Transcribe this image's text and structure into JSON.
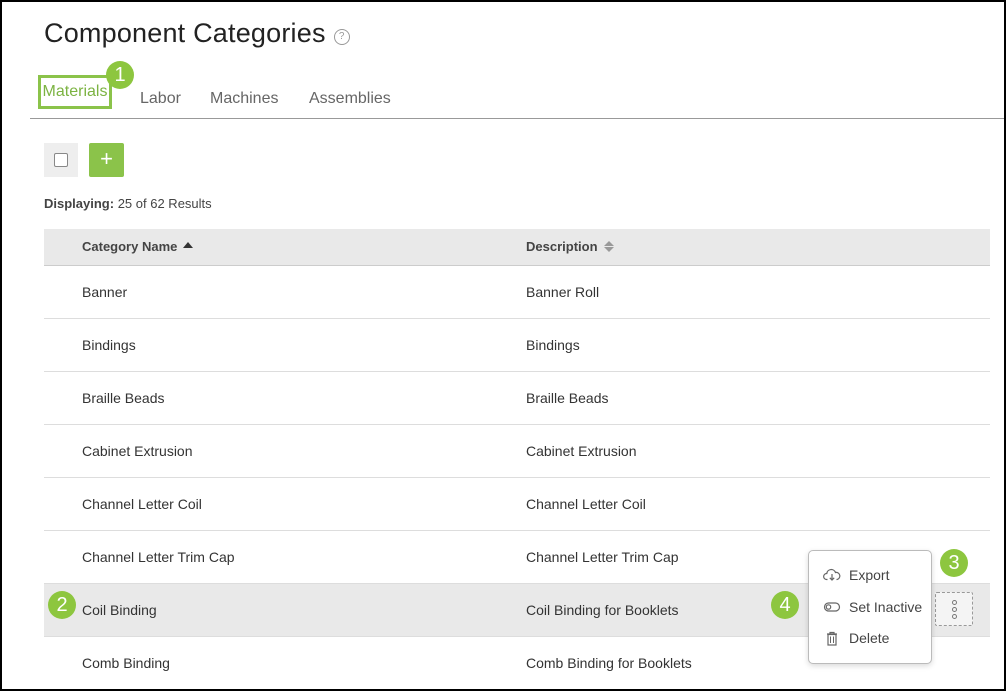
{
  "page": {
    "title": "Component Categories",
    "help_icon": "question-circle-icon"
  },
  "tabs": [
    {
      "label": "Materials",
      "active": true
    },
    {
      "label": "Labor"
    },
    {
      "label": "Machines"
    },
    {
      "label": "Assemblies"
    }
  ],
  "toolbar": {
    "add_label": "+"
  },
  "results": {
    "prefix": "Displaying:",
    "text": "25 of 62 Results"
  },
  "table": {
    "columns": [
      "Category Name",
      "Description"
    ],
    "rows": [
      {
        "name": "Banner",
        "description": "Banner Roll"
      },
      {
        "name": "Bindings",
        "description": "Bindings"
      },
      {
        "name": "Braille Beads",
        "description": "Braille Beads"
      },
      {
        "name": "Cabinet Extrusion",
        "description": "Cabinet Extrusion"
      },
      {
        "name": "Channel Letter Coil",
        "description": "Channel Letter Coil"
      },
      {
        "name": "Channel Letter Trim Cap",
        "description": "Channel Letter Trim Cap"
      },
      {
        "name": "Coil Binding",
        "description": "Coil Binding for Booklets"
      },
      {
        "name": "Comb Binding",
        "description": "Comb Binding for Booklets"
      }
    ]
  },
  "context_menu": {
    "items": [
      {
        "label": "Export",
        "icon": "cloud-download-icon"
      },
      {
        "label": "Set Inactive",
        "icon": "toggle-icon"
      },
      {
        "label": "Delete",
        "icon": "trash-icon"
      }
    ]
  },
  "callouts": [
    "1",
    "2",
    "3",
    "4"
  ],
  "colors": {
    "accent": "#8bc34a",
    "badge": "#8dc63f"
  }
}
